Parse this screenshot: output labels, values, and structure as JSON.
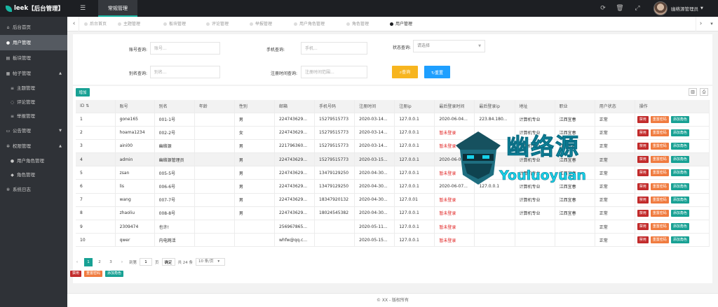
{
  "brand": {
    "name": "leek",
    "title": "【后台管理】"
  },
  "topnav": {
    "menu_icon": "list-icon",
    "main_label": "常规管理",
    "user_name": "幽络源管理员"
  },
  "top_icons": [
    "refresh-icon",
    "trash-icon",
    "fullscreen-icon"
  ],
  "sidebar": {
    "items": [
      {
        "label": "后台首页",
        "icon": "home-icon"
      },
      {
        "label": "用户管理",
        "icon": "user-icon"
      },
      {
        "label": "板块管理",
        "icon": "document-icon"
      },
      {
        "label": "帖子管理",
        "icon": "calendar-icon",
        "arrow": "▲"
      },
      {
        "label": "主题管理",
        "icon": "list-icon"
      },
      {
        "label": "评论管理",
        "icon": "comment-icon"
      },
      {
        "label": "举报管理",
        "icon": "list-icon"
      },
      {
        "label": "公告管理",
        "icon": "folder-icon",
        "arrow": "▼"
      },
      {
        "label": "权限管理",
        "icon": "gear-icon",
        "arrow": "▲"
      },
      {
        "label": "用户角色管理",
        "icon": "users-icon"
      },
      {
        "label": "角色管理",
        "icon": "shield-icon"
      },
      {
        "label": "系统日志",
        "icon": "gear-icon"
      }
    ]
  },
  "tabs": [
    "后台首页",
    "主题管理",
    "板块管理",
    "评论管理",
    "举报管理",
    "用户角色管理",
    "角色管理",
    "用户管理"
  ],
  "search": {
    "account_label": "账号查询:",
    "account_placeholder": "账号...",
    "phone_label": "手机查询:",
    "phone_placeholder": "手机...",
    "status_label": "状态查询:",
    "status_value": "请选择",
    "alias_label": "别名查询:",
    "alias_placeholder": "别名...",
    "regtime_label": "注册时间查询:",
    "regtime_placeholder": "注册时间范围...",
    "query_button": "查询",
    "reset_button": "重置"
  },
  "toolbar": {
    "add_label": "增加"
  },
  "table": {
    "columns": [
      "ID",
      "账号",
      "别名",
      "年龄",
      "性别",
      "邮箱",
      "手机号码",
      "注册时间",
      "注册ip",
      "最后登录时间",
      "最后登录ip",
      "地址",
      "职业",
      "用户状态",
      "操作"
    ],
    "rows": [
      [
        "1",
        "gone165",
        "001-1号",
        "",
        "男",
        "22474362​9...",
        "15279515773",
        "2020-03-14...",
        "127.0.0.1",
        "2020-06-04...",
        "223.84.180...",
        "计算机专业",
        "江西宜春",
        "正常"
      ],
      [
        "2",
        "hoama1234",
        "002-2号",
        "",
        "女",
        "22474362​9...",
        "15279515773",
        "2020-03-14...",
        "127.0.0.1",
        "暂未登录",
        "",
        "计算机专业",
        "江西宜春",
        "正常"
      ],
      [
        "3",
        "aini00",
        "幽络源",
        "",
        "男",
        "22179636​0...",
        "15279515773",
        "2020-03-14...",
        "127.0.0.1",
        "暂未登录",
        "",
        "计算机专业",
        "江西宜春",
        "正常"
      ],
      [
        "4",
        "admin",
        "幽络源管理员",
        "",
        "男",
        "22474362​9...",
        "15279515773",
        "2020-03-15...",
        "127.0.0.1",
        "2020-06-07...",
        "",
        "计算机专业",
        "江西宜春",
        "正常"
      ],
      [
        "5",
        "zsan",
        "005-5号",
        "",
        "男",
        "22474362​9...",
        "13479129250",
        "2020-04-30...",
        "127.0.0.1",
        "暂未登录",
        "",
        "计算机专业",
        "江西宜春",
        "正常"
      ],
      [
        "6",
        "lis",
        "006-6号",
        "",
        "男",
        "22474362​9...",
        "13479129250",
        "2020-04-30...",
        "127.0.0.1",
        "2020-06-07...",
        "127.0.0.1",
        "计算机专业",
        "江西宜春",
        "正常"
      ],
      [
        "7",
        "wang",
        "007-7号",
        "",
        "男",
        "22474362​9...",
        "18347920132",
        "2020-04-30...",
        "127.0.01",
        "暂未登录",
        "",
        "计算机专业",
        "江西宜春",
        "正常"
      ],
      [
        "8",
        "zhaoliu",
        "008-8号",
        "",
        "男",
        "22474362​9...",
        "18024545382",
        "2020-04-30...",
        "127.0.0.1",
        "暂未登录",
        "",
        "计算机专业",
        "江西宜春",
        "正常"
      ],
      [
        "9",
        "2309474",
        "也许!",
        "",
        "",
        "25696786​5...",
        "",
        "2020-05-11...",
        "127.0.0.1",
        "暂未登录",
        "",
        "",
        "",
        "正常"
      ],
      [
        "10",
        "qwer",
        "内电网活",
        "",
        "",
        "whfw@qq.c...",
        "",
        "2020-05-15...",
        "127.0.0.1",
        "暂未登录",
        "",
        "",
        "",
        "正常"
      ]
    ],
    "row_actions": [
      "禁用",
      "重置密码",
      "添加角色"
    ]
  },
  "pager": {
    "pages": [
      "1",
      "2",
      "3"
    ],
    "current": "1",
    "goto_label": "到第",
    "page_input": "1",
    "page_suffix": "页",
    "confirm": "确定",
    "total": "共 24 条",
    "per_page": "10 条/页"
  },
  "bulk_actions": [
    "禁用",
    "重置密码",
    "添加角色"
  ],
  "footer": "© XX - 版权所有",
  "watermark": {
    "title": "幽络源",
    "subtitle": "Youluoyuan"
  },
  "colors": {
    "accent": "#18a194",
    "danger": "#c22b2b",
    "warning": "#f07b3f",
    "query": "#f7b51f",
    "reset": "#1e9fff"
  }
}
